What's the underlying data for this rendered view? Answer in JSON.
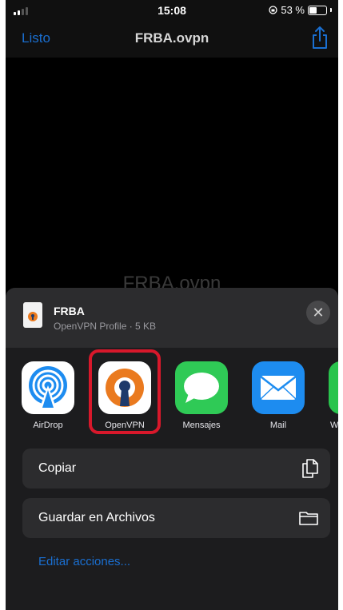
{
  "status_bar": {
    "time": "15:08",
    "battery_text": "53 %"
  },
  "nav": {
    "done_label": "Listo",
    "title": "FRBA.ovpn",
    "share_icon": "share-icon"
  },
  "background_filename": "FRBA.ovpn",
  "sheet": {
    "file": {
      "name": "FRBA",
      "meta": "OpenVPN Profile · 5 KB",
      "icon": "openvpn-file-icon"
    },
    "apps": [
      {
        "label": "AirDrop",
        "icon": "airdrop-icon",
        "color": "#ffffff"
      },
      {
        "label": "OpenVPN",
        "icon": "openvpn-icon",
        "color": "#ea7a1f"
      },
      {
        "label": "Mensajes",
        "icon": "messages-icon",
        "color": "#2fca56"
      },
      {
        "label": "Mail",
        "icon": "mail-icon",
        "color": "#1d8cf0"
      },
      {
        "label": "W",
        "icon": "whatsapp-icon",
        "color": "#29c44d"
      }
    ],
    "actions": [
      {
        "label": "Copiar",
        "icon": "copy-icon"
      },
      {
        "label": "Guardar en Archivos",
        "icon": "folder-icon"
      }
    ],
    "edit_actions_label": "Editar acciones..."
  },
  "colors": {
    "accent": "#1a6fd1",
    "highlight": "#d8182b",
    "sheet": "#1c1c1e"
  }
}
